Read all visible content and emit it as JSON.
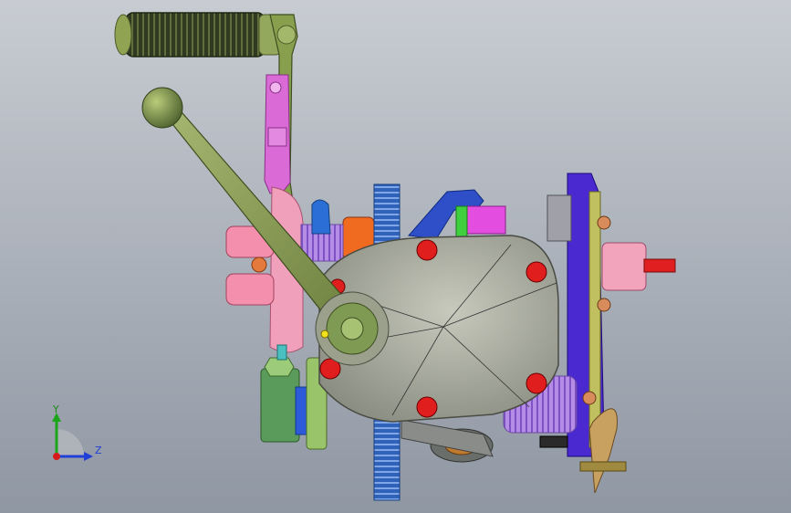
{
  "triad": {
    "y_label": "Y",
    "z_label": "Z",
    "y_color": "#1aa51a",
    "z_color": "#1f3fd6",
    "x_color": "#d61a1a"
  },
  "colors": {
    "bg_top": "#c8ccd2",
    "bg_bottom": "#8f97a3",
    "lever": "#8ea35a",
    "grip": "#3f4a2c",
    "cover": "#a5a79a",
    "bolt": "#e01e1e",
    "pink": "#f08bb0",
    "magenta": "#d04ad0",
    "blue": "#2c4fd0",
    "purple": "#5a2cd6",
    "gear_blue": "#3a6fc0",
    "orange": "#f06a20",
    "green_block": "#4c8a4c",
    "lavender": "#b99be0"
  }
}
